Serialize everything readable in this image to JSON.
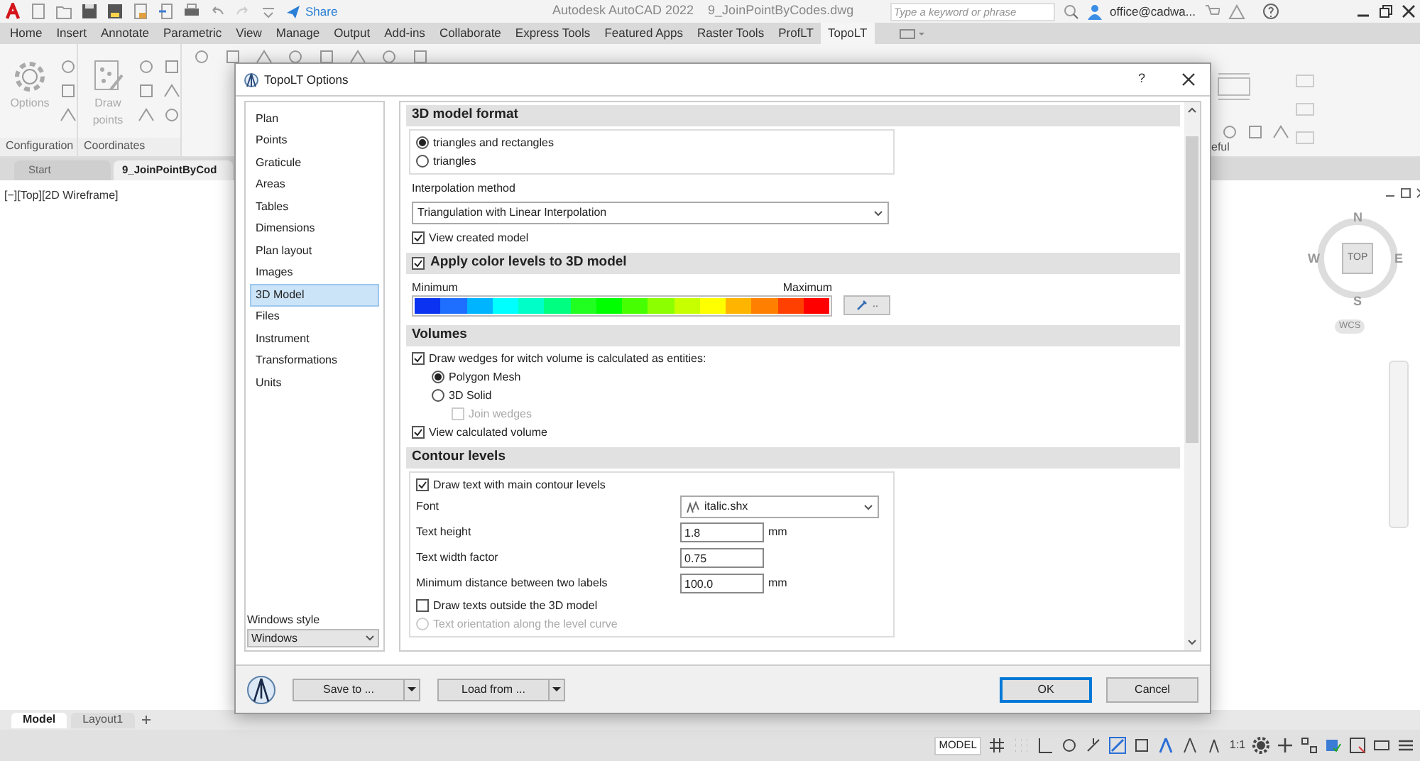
{
  "app": {
    "title": "Autodesk AutoCAD 2022",
    "file": "9_JoinPointByCodes.dwg",
    "share": "Share",
    "search_placeholder": "Type a keyword or phrase",
    "user": "office@cadwa..."
  },
  "ribbon_tabs": [
    {
      "label": "Home",
      "selected": false
    },
    {
      "label": "Insert",
      "selected": false
    },
    {
      "label": "Annotate",
      "selected": false
    },
    {
      "label": "Parametric",
      "selected": false
    },
    {
      "label": "View",
      "selected": false
    },
    {
      "label": "Manage",
      "selected": false
    },
    {
      "label": "Output",
      "selected": false
    },
    {
      "label": "Add-ins",
      "selected": false
    },
    {
      "label": "Collaborate",
      "selected": false
    },
    {
      "label": "Express Tools",
      "selected": false
    },
    {
      "label": "Featured Apps",
      "selected": false
    },
    {
      "label": "Raster Tools",
      "selected": false
    },
    {
      "label": "ProfLT",
      "selected": false
    },
    {
      "label": "TopoLT",
      "selected": true
    }
  ],
  "ribbon_panels": [
    {
      "title": "Configuration",
      "button": "Options"
    },
    {
      "title": "Coordinates",
      "button": "Draw points"
    }
  ],
  "ribbon_right_panel_title": "eful",
  "file_tabs": [
    {
      "label": "Start",
      "selected": false
    },
    {
      "label": "9_JoinPointByCod",
      "selected": true
    }
  ],
  "viewport_label": "[−][Top][2D Wireframe]",
  "viewcube": {
    "north": "N",
    "south": "S",
    "east": "E",
    "west": "W",
    "face": "TOP",
    "ucs": "WCS"
  },
  "layout_tabs": [
    {
      "label": "Model",
      "selected": true
    },
    {
      "label": "Layout1",
      "selected": false
    }
  ],
  "status_bar": {
    "model": "MODEL",
    "scale": "1:1"
  },
  "dialog": {
    "title": "TopoLT Options",
    "help": "?",
    "categories": [
      {
        "label": "Plan",
        "selected": false
      },
      {
        "label": "Points",
        "selected": false
      },
      {
        "label": "Graticule",
        "selected": false
      },
      {
        "label": "Areas",
        "selected": false
      },
      {
        "label": "Tables",
        "selected": false
      },
      {
        "label": "Dimensions",
        "selected": false
      },
      {
        "label": "Plan layout",
        "selected": false
      },
      {
        "label": "Images",
        "selected": false
      },
      {
        "label": "3D Model",
        "selected": true
      },
      {
        "label": "Files",
        "selected": false
      },
      {
        "label": "Instrument",
        "selected": false
      },
      {
        "label": "Transformations",
        "selected": false
      },
      {
        "label": "Units",
        "selected": false
      }
    ],
    "windows_style": {
      "label": "Windows style",
      "value": "Windows"
    },
    "sections": [
      {
        "title": "3D model format",
        "items": [
          {
            "kind": "group",
            "items": [
              {
                "kind": "radio",
                "label": "triangles and rectangles",
                "selected": true
              },
              {
                "kind": "radio",
                "label": "triangles",
                "selected": false
              }
            ]
          },
          {
            "kind": "label",
            "label": "Interpolation method"
          },
          {
            "kind": "dropdown",
            "value": "Triangulation with Linear Interpolation"
          },
          {
            "kind": "checkbox",
            "label": "View created model",
            "checked": true
          }
        ]
      },
      {
        "title": "Apply color levels to 3D model",
        "checked": true,
        "items": [
          {
            "kind": "color_scale",
            "min_label": "Minimum",
            "max_label": "Maximum",
            "swatches": [
              {
                "color": "#0a32f0"
              },
              {
                "color": "#1e6eff"
              },
              {
                "color": "#00b4ff"
              },
              {
                "color": "#00ffff"
              },
              {
                "color": "#00ffc8"
              },
              {
                "color": "#00ff80"
              },
              {
                "color": "#20ff20"
              },
              {
                "color": "#00ff00"
              },
              {
                "color": "#46ff00"
              },
              {
                "color": "#8cff00"
              },
              {
                "color": "#c8ff00"
              },
              {
                "color": "#ffff00"
              },
              {
                "color": "#ffb400"
              },
              {
                "color": "#ff8000"
              },
              {
                "color": "#ff4000"
              },
              {
                "color": "#ff0000"
              }
            ],
            "button": ".."
          }
        ]
      },
      {
        "title": "Volumes",
        "items": [
          {
            "kind": "checkbox",
            "label": "Draw wedges for witch volume is calculated as entities:",
            "checked": true,
            "children": [
              {
                "kind": "radio",
                "label": "Polygon Mesh",
                "selected": true
              },
              {
                "kind": "radio",
                "label": "3D Solid",
                "selected": false,
                "children": [
                  {
                    "kind": "checkbox",
                    "label": "Join wedges",
                    "checked": false,
                    "disabled": true
                  }
                ]
              }
            ]
          },
          {
            "kind": "checkbox",
            "label": "View calculated volume",
            "checked": true
          }
        ]
      },
      {
        "title": "Contour levels",
        "items": [
          {
            "kind": "group",
            "items": [
              {
                "kind": "checkbox",
                "label": "Draw text with main contour levels",
                "checked": true
              },
              {
                "kind": "dropdown_row",
                "label": "Font",
                "value": "italic.shx"
              },
              {
                "kind": "field_row",
                "label": "Text height",
                "value": "1.8",
                "unit": "mm"
              },
              {
                "kind": "field_row",
                "label": "Text width factor",
                "value": "0.75"
              },
              {
                "kind": "field_row",
                "label": "Minimum distance between two labels",
                "value": "100.0",
                "unit": "mm"
              },
              {
                "kind": "checkbox",
                "label": "Draw texts outside the 3D model",
                "checked": false
              },
              {
                "kind": "radio",
                "label": "Text orientation along the level curve",
                "selected": false,
                "disabled": true
              }
            ]
          }
        ]
      }
    ],
    "buttons": [
      {
        "label": "Save to ...",
        "kind": "split"
      },
      {
        "label": "Load from ...",
        "kind": "split"
      },
      {
        "label": "OK",
        "kind": "default"
      },
      {
        "label": "Cancel",
        "kind": "plain"
      }
    ]
  }
}
